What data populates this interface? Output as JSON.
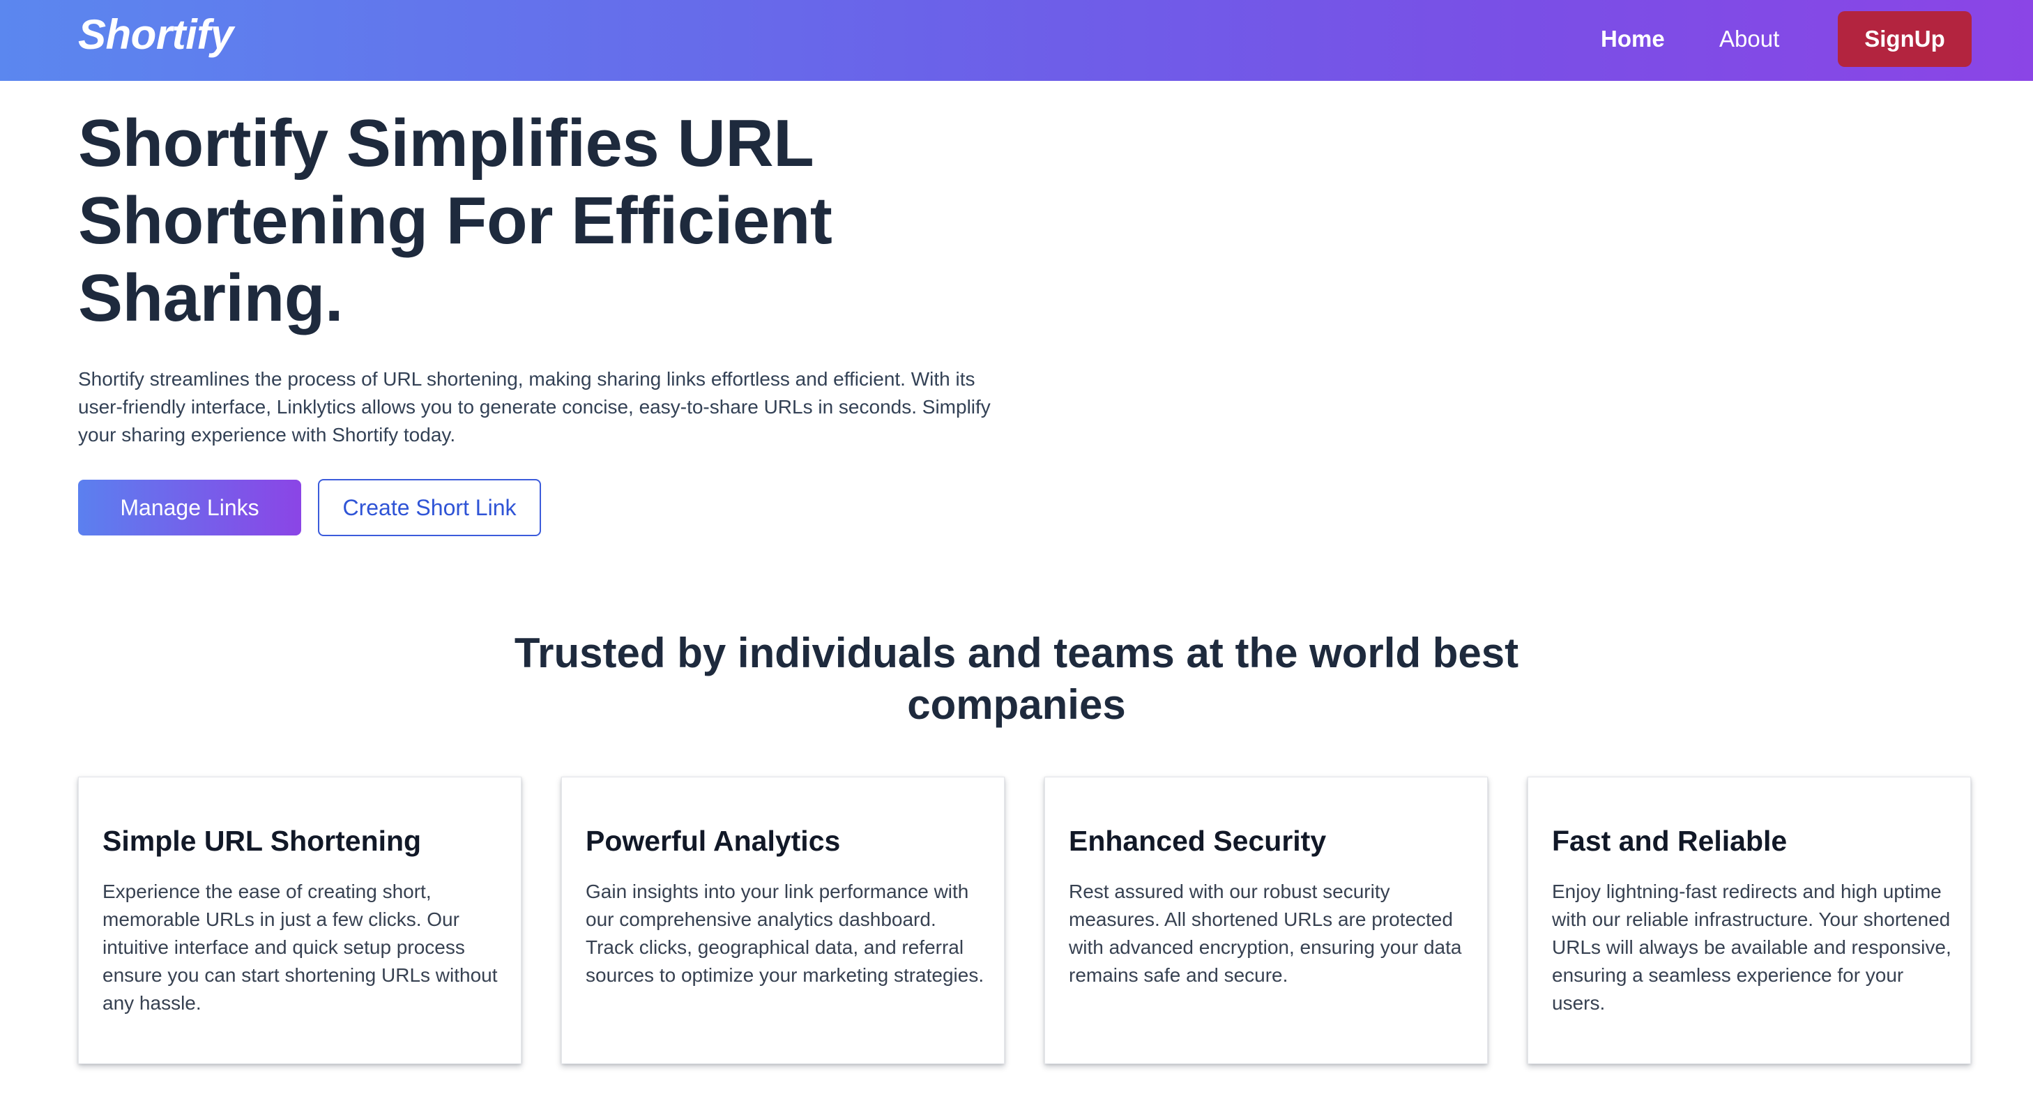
{
  "navbar": {
    "brand": "Shortify",
    "links": [
      {
        "label": "Home"
      },
      {
        "label": "About"
      }
    ],
    "signup_label": "SignUp"
  },
  "hero": {
    "title": "Shortify Simplifies URL Shortening For Efficient Sharing.",
    "description": "Shortify streamlines the process of URL shortening, making sharing links effortless and efficient. With its user-friendly interface, Linklytics allows you to generate concise, easy-to-share URLs in seconds. Simplify your sharing experience with Shortify today.",
    "primary_button": "Manage Links",
    "secondary_button": "Create Short Link"
  },
  "trusted": {
    "title": "Trusted by individuals and teams at the world best companies"
  },
  "features": [
    {
      "title": "Simple URL Shortening",
      "text": "Experience the ease of creating short, memorable URLs in just a few clicks. Our intuitive interface and quick setup process ensure you can start shortening URLs without any hassle."
    },
    {
      "title": "Powerful Analytics",
      "text": "Gain insights into your link performance with our comprehensive analytics dashboard. Track clicks, geographical data, and referral sources to optimize your marketing strategies."
    },
    {
      "title": "Enhanced Security",
      "text": "Rest assured with our robust security measures. All shortened URLs are protected with advanced encryption, ensuring your data remains safe and secure."
    },
    {
      "title": "Fast and Reliable",
      "text": "Enjoy lightning-fast redirects and high uptime with our reliable infrastructure. Your shortened URLs will always be available and responsive, ensuring a seamless experience for your users."
    }
  ],
  "colors": {
    "navbar_gradient_start": "#5b87ef",
    "navbar_gradient_end": "#8b45e6",
    "signup_button": "#b3243f",
    "outline_button_border": "#3b5bdb",
    "heading_text": "#1e2a3d"
  }
}
